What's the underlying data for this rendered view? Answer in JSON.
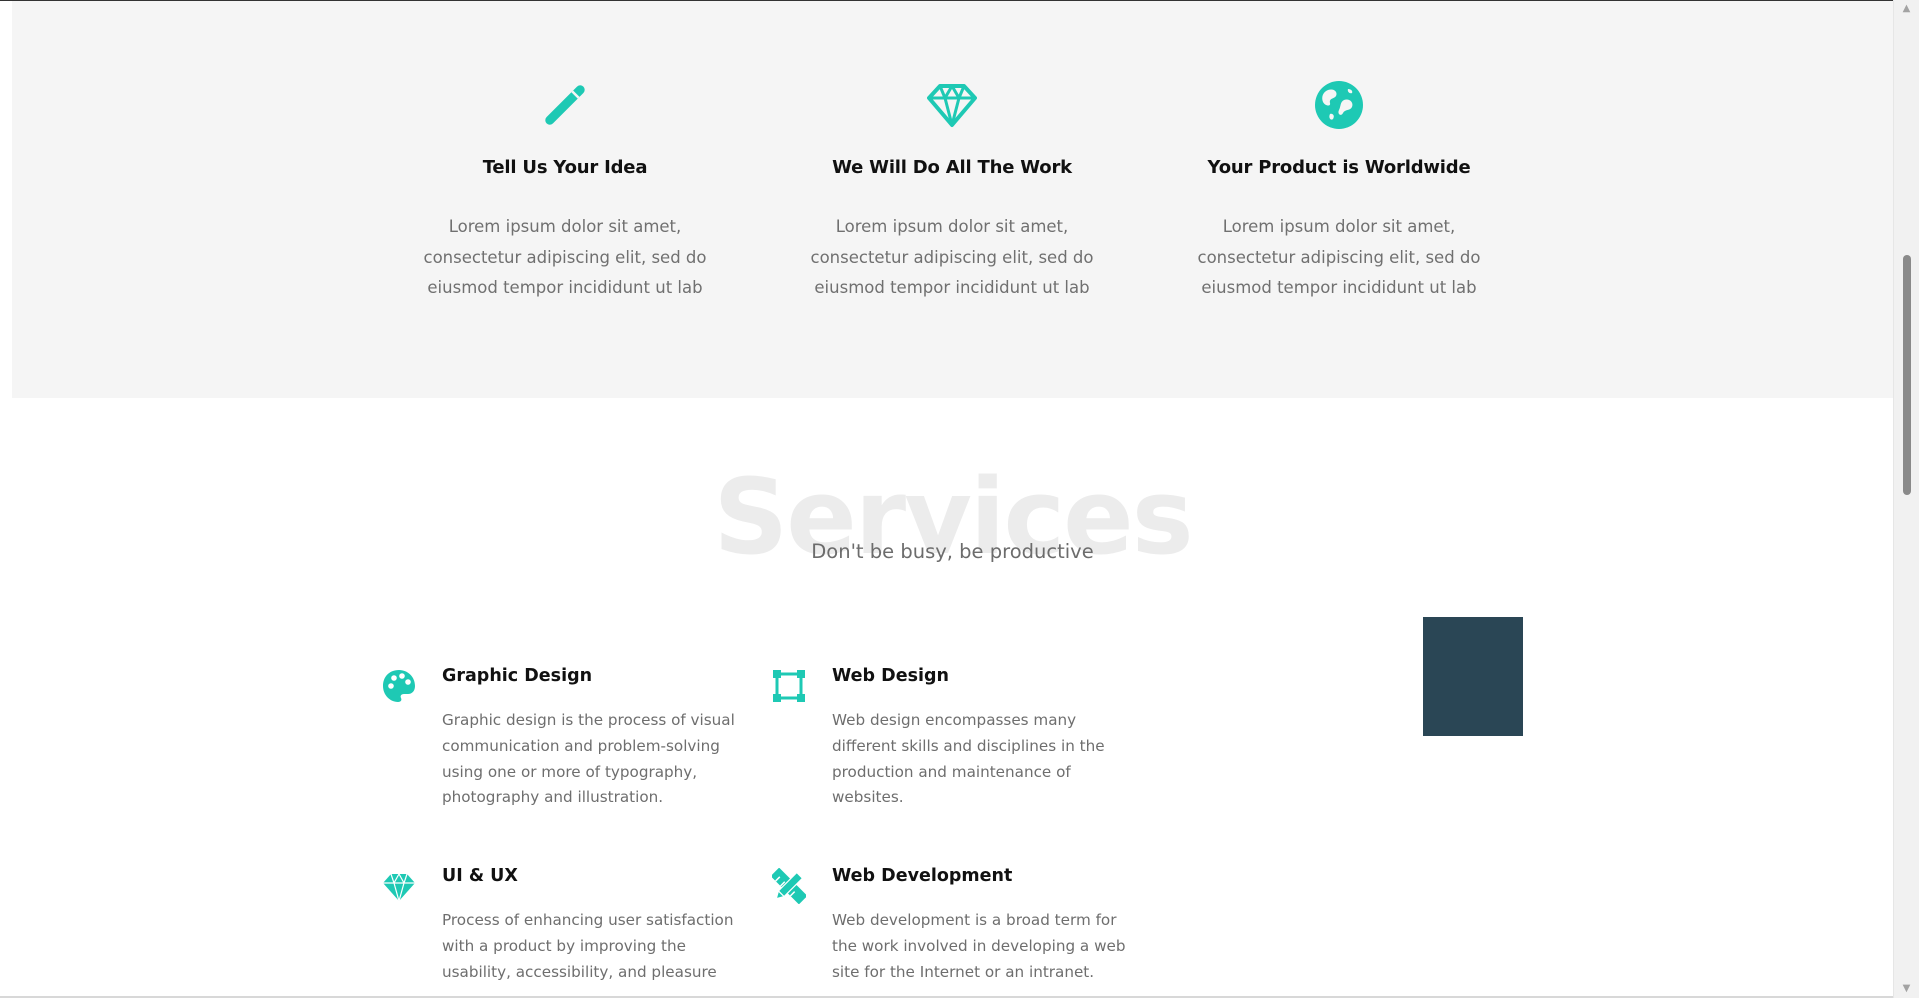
{
  "colors": {
    "accent": "#1ec9b4",
    "dark_box": "#2a4655",
    "feature_bg": "#f5f5f5"
  },
  "features": [
    {
      "icon": "brush-icon",
      "title": "Tell Us Your Idea",
      "text": "Lorem ipsum dolor sit amet, consectetur adipiscing elit, sed do eiusmod tempor incididunt ut lab"
    },
    {
      "icon": "diamond-icon",
      "title": "We Will Do All The Work",
      "text": "Lorem ipsum dolor sit amet, consectetur adipiscing elit, sed do eiusmod tempor incididunt ut lab"
    },
    {
      "icon": "globe-icon",
      "title": "Your Product is Worldwide",
      "text": "Lorem ipsum dolor sit amet, consectetur adipiscing elit, sed do eiusmod tempor incididunt ut lab"
    }
  ],
  "services": {
    "title": "Services",
    "subtitle": "Don't be busy, be productive",
    "items": [
      {
        "icon": "palette-icon",
        "title": "Graphic Design",
        "text": "Graphic design is the process of visual communication and problem-solving using one or more of typography, photography and illustration."
      },
      {
        "icon": "vector-square-icon",
        "title": "Web Design",
        "text": "Web design encompasses many different skills and disciplines in the production and maintenance of websites."
      },
      {
        "icon": "gem-icon",
        "title": "UI & UX",
        "text": "Process of enhancing user satisfaction with a product by improving the usability, accessibility, and pleasure"
      },
      {
        "icon": "pencil-ruler-icon",
        "title": "Web Development",
        "text": "Web development is a broad term for the work involved in developing a web site for the Internet or an intranet."
      }
    ]
  },
  "scrollbar": {
    "up_arrow": "▲",
    "down_arrow": "▼"
  }
}
